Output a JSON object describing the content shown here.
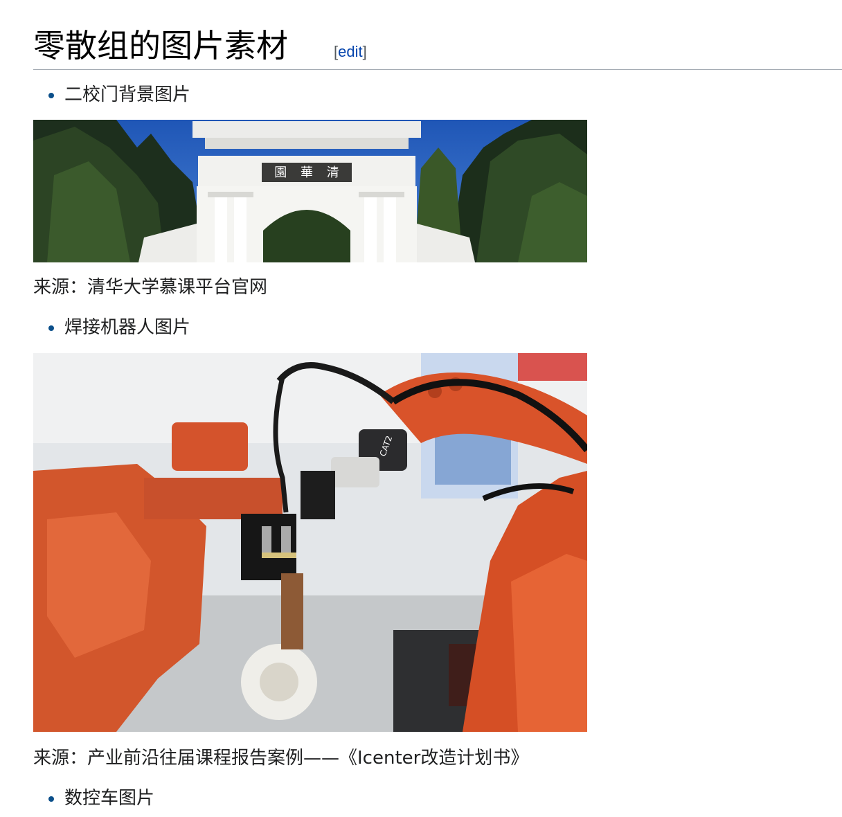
{
  "section": {
    "title": "零散组的图片素材",
    "edit_open": "[",
    "edit_label": "edit",
    "edit_close": "]"
  },
  "items": [
    {
      "label": "二校门背景图片",
      "caption": "来源：清华大学慕课平台官网"
    },
    {
      "label": "焊接机器人图片",
      "caption": "来源：产业前沿往届课程报告案例——《Icenter改造计划书》"
    },
    {
      "label": "数控车图片"
    }
  ],
  "gate_sign": [
    "清",
    "華",
    "園"
  ],
  "robot_label": "CAT2"
}
